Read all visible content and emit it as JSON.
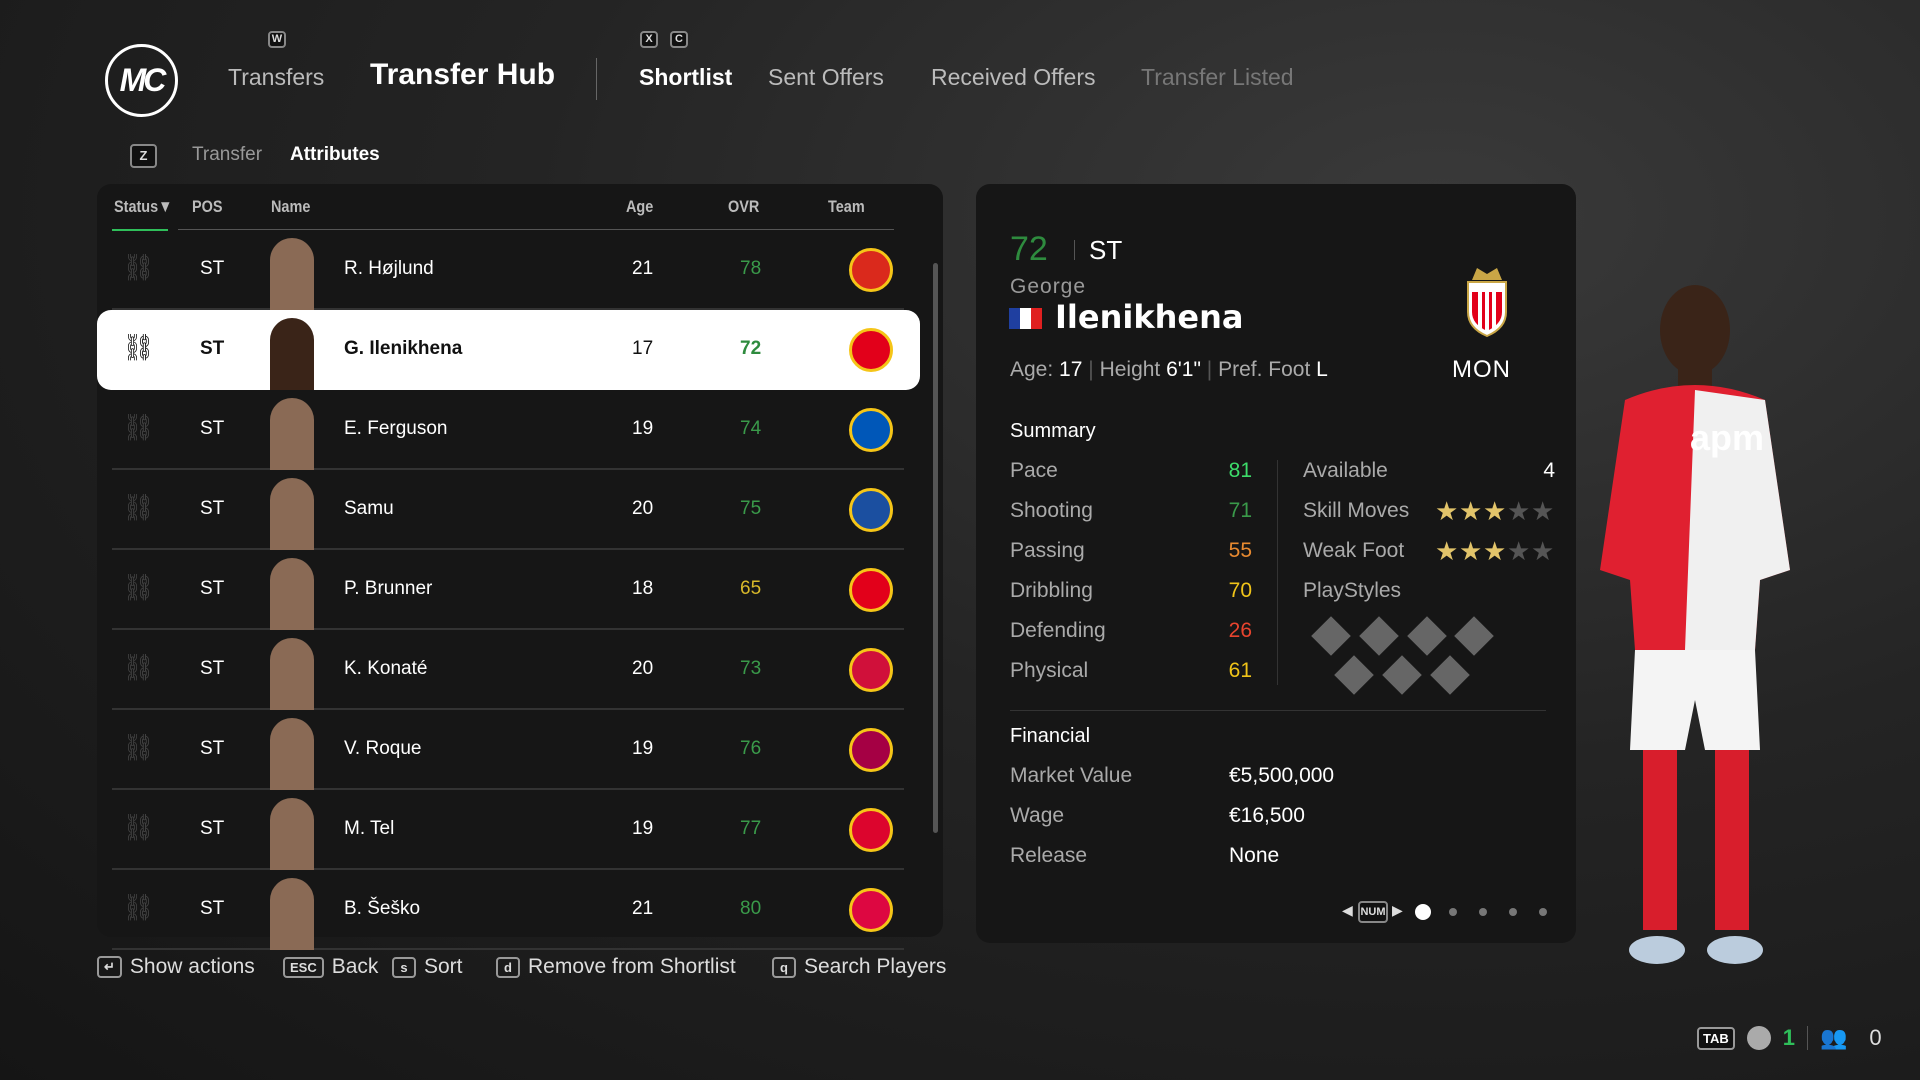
{
  "header": {
    "logo_text": "MC",
    "keys": {
      "w": "W",
      "x": "X",
      "c": "C",
      "z": "Z"
    },
    "tabs": [
      {
        "label": "Transfers"
      },
      {
        "label": "Transfer Hub"
      },
      {
        "label": "Shortlist"
      },
      {
        "label": "Sent Offers"
      },
      {
        "label": "Received Offers"
      },
      {
        "label": "Transfer Listed"
      }
    ],
    "subtabs": [
      {
        "label": "Transfer"
      },
      {
        "label": "Attributes"
      }
    ]
  },
  "table": {
    "columns": [
      "Status",
      "POS",
      "Name",
      "Age",
      "OVR",
      "Team"
    ],
    "sort_indicator": "▼",
    "rows": [
      {
        "pos": "ST",
        "name": "R. Højlund",
        "age": "21",
        "ovr": "78",
        "ovr_color": "#3a9a4a",
        "crest": "man-utd-crest",
        "crest_color": "#da291c"
      },
      {
        "pos": "ST",
        "name": "G. Ilenikhena",
        "age": "17",
        "ovr": "72",
        "ovr_color": "#2e8b3e",
        "crest": "monaco-crest",
        "crest_color": "#e2001a",
        "selected": true
      },
      {
        "pos": "ST",
        "name": "E. Ferguson",
        "age": "19",
        "ovr": "74",
        "ovr_color": "#3a9a4a",
        "crest": "brighton-crest",
        "crest_color": "#0057b8"
      },
      {
        "pos": "ST",
        "name": "Samu",
        "age": "20",
        "ovr": "75",
        "ovr_color": "#3a9a4a",
        "crest": "porto-crest",
        "crest_color": "#1b4fa0"
      },
      {
        "pos": "ST",
        "name": "P. Brunner",
        "age": "18",
        "ovr": "65",
        "ovr_color": "#d8b82a",
        "crest": "monaco-crest",
        "crest_color": "#e2001a"
      },
      {
        "pos": "ST",
        "name": "K. Konaté",
        "age": "20",
        "ovr": "73",
        "ovr_color": "#3a9a4a",
        "crest": "salzburg-crest",
        "crest_color": "#d0103a"
      },
      {
        "pos": "ST",
        "name": "V. Roque",
        "age": "19",
        "ovr": "76",
        "ovr_color": "#3a9a4a",
        "crest": "barcelona-crest",
        "crest_color": "#a50044"
      },
      {
        "pos": "ST",
        "name": "M. Tel",
        "age": "19",
        "ovr": "77",
        "ovr_color": "#3a9a4a",
        "crest": "bayern-crest",
        "crest_color": "#dc052d"
      },
      {
        "pos": "ST",
        "name": "B. Šeško",
        "age": "21",
        "ovr": "80",
        "ovr_color": "#3a9a4a",
        "crest": "leipzig-crest",
        "crest_color": "#dd0741"
      }
    ]
  },
  "player": {
    "ovr": "72",
    "position": "ST",
    "first_name": "George",
    "last_name": "Ilenikhena",
    "nationality_flag": "france-flag",
    "age_label": "Age:",
    "age": "17",
    "height_label": "Height",
    "height": "6'1\"",
    "foot_label": "Pref. Foot",
    "foot": "L",
    "team_code": "MON",
    "summary_title": "Summary",
    "stats": [
      {
        "label": "Pace",
        "value": "81",
        "color": "#3ddc6a"
      },
      {
        "label": "Shooting",
        "value": "71",
        "color": "#3a9a4a"
      },
      {
        "label": "Passing",
        "value": "55",
        "color": "#e88a30"
      },
      {
        "label": "Dribbling",
        "value": "70",
        "color": "#f0c419"
      },
      {
        "label": "Defending",
        "value": "26",
        "color": "#e8442e"
      },
      {
        "label": "Physical",
        "value": "61",
        "color": "#f0c419"
      }
    ],
    "available_label": "Available",
    "available": "4",
    "skill_moves_label": "Skill Moves",
    "skill_moves": 3,
    "weak_foot_label": "Weak Foot",
    "weak_foot": 3,
    "playstyles_label": "PlayStyles",
    "financial_title": "Financial",
    "market_value_label": "Market Value",
    "market_value": "€5,500,000",
    "wage_label": "Wage",
    "wage": "€16,500",
    "release_label": "Release",
    "release": "None",
    "pager": {
      "key": "NUM",
      "pages": 5,
      "current": 1
    }
  },
  "footer": [
    {
      "key": "↵",
      "label": "Show actions"
    },
    {
      "key": "ESC",
      "label": "Back"
    },
    {
      "key": "s",
      "label": "Sort"
    },
    {
      "key": "d",
      "label": "Remove from Shortlist"
    },
    {
      "key": "q",
      "label": "Search Players"
    }
  ],
  "status_bar": {
    "key": "TAB",
    "online_count": "1",
    "friends_count": "0"
  },
  "colors": {
    "accent_green": "#2fbf5a",
    "panel": "#161616"
  }
}
